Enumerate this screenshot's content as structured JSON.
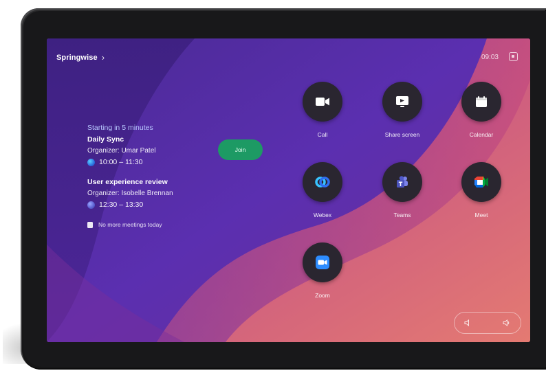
{
  "header": {
    "brand": "Springwise",
    "brand_chevron": "›",
    "clock": "09:03",
    "top_icon": "layout-icon"
  },
  "meetings": {
    "starting_in": "Starting in 5 minutes",
    "items": [
      {
        "title": "Daily Sync",
        "organizer": "Organizer: Umar Patel",
        "time": "10:00 – 11:30",
        "service_icon": "webex-icon"
      },
      {
        "title": "User experience review",
        "organizer": "Organizer: Isobelle Brennan",
        "time": "12:30 – 13:30",
        "service_icon": "teams-icon"
      }
    ],
    "no_more": "No more meetings today",
    "join_label": "Join"
  },
  "tiles": [
    {
      "label": "Call",
      "icon": "video-camera-icon"
    },
    {
      "label": "Share screen",
      "icon": "share-screen-icon"
    },
    {
      "label": "Calendar",
      "icon": "calendar-icon"
    },
    {
      "label": "Webex",
      "icon": "webex-icon"
    },
    {
      "label": "Teams",
      "icon": "teams-icon"
    },
    {
      "label": "Meet",
      "icon": "google-meet-icon"
    },
    {
      "label": "Zoom",
      "icon": "zoom-icon"
    }
  ],
  "volume": {
    "down_icon": "volume-down-icon",
    "up_icon": "volume-up-icon"
  },
  "colors": {
    "join_green": "#1d9a64",
    "tile_bg": "#2a2630",
    "starting_text": "#b9c9ff"
  }
}
